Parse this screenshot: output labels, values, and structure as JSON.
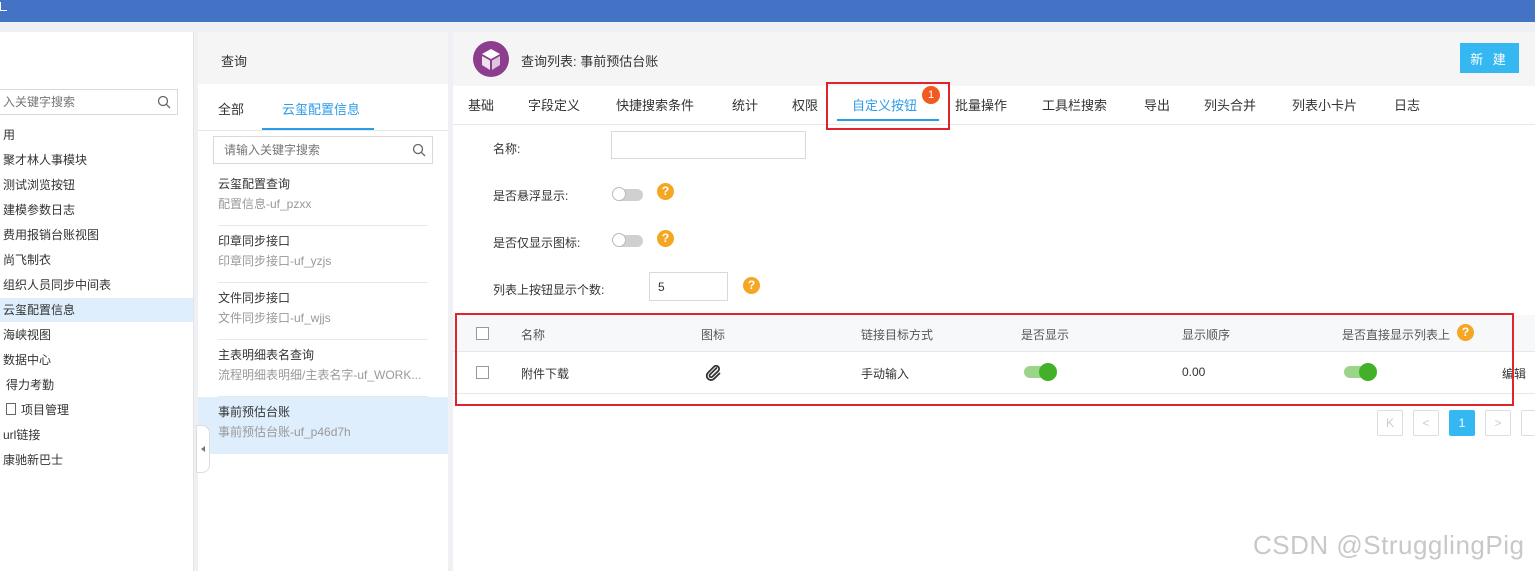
{
  "colors": {
    "topbar": "#4472c4",
    "accent": "#2d9ce8",
    "new_button": "#35b8f1",
    "badge": "#f25a1f",
    "highlight_box": "#e0242b",
    "toggle_on": "#43b02a",
    "help": "#f5a623"
  },
  "left_tree": {
    "search_placeholder": "入关键字搜索",
    "items": [
      {
        "label": "用"
      },
      {
        "label": "聚才林人事模块"
      },
      {
        "label": "测试浏览按钮"
      },
      {
        "label": "建模参数日志"
      },
      {
        "label": "费用报销台账视图"
      },
      {
        "label": "尚飞制衣"
      },
      {
        "label": "组织人员同步中间表"
      },
      {
        "label": "云玺配置信息",
        "active": true
      },
      {
        "label": "海峡视图"
      },
      {
        "label": "数据中心"
      },
      {
        "label": "得力考勤"
      },
      {
        "label": "项目管理",
        "icon": "document-icon"
      },
      {
        "label": "url链接"
      },
      {
        "label": "康驰新巴士"
      }
    ]
  },
  "middle": {
    "header": "查询",
    "tabs": [
      "全部",
      "云玺配置信息"
    ],
    "active_tab": "云玺配置信息",
    "search_placeholder": "请输入关键字搜索",
    "items": [
      {
        "title": "云玺配置查询",
        "sub": "配置信息-uf_pzxx"
      },
      {
        "title": "印章同步接口",
        "sub": "印章同步接口-uf_yzjs"
      },
      {
        "title": "文件同步接口",
        "sub": "文件同步接口-uf_wjjs"
      },
      {
        "title": "主表明细表名查询",
        "sub": "流程明细表明细/主表名字-uf_WORK..."
      },
      {
        "title": "事前预估台账",
        "sub": "事前预估台账-uf_p46d7h",
        "active": true
      }
    ]
  },
  "main": {
    "title": "查询列表: 事前预估台账",
    "new_button": "新 建",
    "tabs": [
      "基础",
      "字段定义",
      "快捷搜索条件",
      "统计",
      "权限",
      "自定义按钮",
      "批量操作",
      "工具栏搜索",
      "导出",
      "列头合并",
      "列表小卡片",
      "日志"
    ],
    "active_tab": "自定义按钮",
    "tab_badge": "1",
    "form": {
      "name_label": "名称:",
      "name_value": "",
      "float_label": "是否悬浮显示:",
      "float_on": false,
      "icon_only_label": "是否仅显示图标:",
      "icon_only_on": false,
      "count_label": "列表上按钮显示个数:",
      "count_value": "5",
      "help": "?"
    },
    "table": {
      "headers": [
        "名称",
        "图标",
        "链接目标方式",
        "是否显示",
        "显示顺序",
        "是否直接显示列表上"
      ],
      "rows": [
        {
          "name": "附件下载",
          "icon": "paperclip-icon",
          "link_mode": "手动输入",
          "show": true,
          "order": "0.00",
          "direct": true,
          "action": "编辑"
        }
      ]
    },
    "pagination": {
      "current": "1",
      "first": "K",
      "prev": "<",
      "next": ">"
    }
  },
  "watermark": "CSDN @StrugglingPig"
}
